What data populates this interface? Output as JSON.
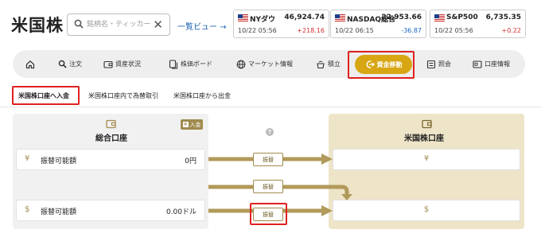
{
  "header": {
    "title": "米国株",
    "search_placeholder": "銘柄名・ティッカー",
    "list_view_label": "一覧ビュー →"
  },
  "tickers": [
    {
      "name": "NYダウ",
      "value": "46,924.74",
      "time": "10/22 05:56",
      "change": "+218.16",
      "direction": "up"
    },
    {
      "name": "NASDAQ総合",
      "value": "22,953.66",
      "time": "10/22 06:15",
      "change": "-36.87",
      "direction": "down"
    },
    {
      "name": "S&P500",
      "value": "6,735.35",
      "time": "10/22 05:56",
      "change": "+0.22",
      "direction": "up"
    }
  ],
  "nav": {
    "items": [
      {
        "label": "",
        "icon": "home-icon"
      },
      {
        "label": "注文",
        "icon": "search-icon"
      },
      {
        "label": "資産状況",
        "icon": "wallet-icon"
      },
      {
        "label": "株価ボード",
        "icon": "board-icon"
      },
      {
        "label": "マーケット情報",
        "icon": "globe-icon"
      },
      {
        "label": "積立",
        "icon": "pot-icon"
      },
      {
        "label": "資金移動",
        "icon": "transfer-icon"
      },
      {
        "label": "照会",
        "icon": "list-icon"
      },
      {
        "label": "口座情報",
        "icon": "account-icon"
      }
    ],
    "active": "資金移動"
  },
  "subtabs": [
    {
      "label": "米国株口座へ入金",
      "active": true
    },
    {
      "label": "米国株口座内で為替取引",
      "active": false
    },
    {
      "label": "米国株口座から出金",
      "active": false
    }
  ],
  "left_account": {
    "title": "総合口座",
    "deposit_label": "入金",
    "rows": [
      {
        "currency": "¥",
        "label": "振替可能額",
        "amount": "0円"
      },
      {
        "currency": "$",
        "label": "振替可能額",
        "amount": "0.00ドル"
      }
    ]
  },
  "right_account": {
    "title": "米国株口座",
    "rows": [
      {
        "currency": "¥"
      },
      {
        "currency": "$"
      }
    ]
  },
  "help_label": "?",
  "transfer_buttons": [
    {
      "label": "振替"
    },
    {
      "label": "振替"
    },
    {
      "label": "振替"
    }
  ],
  "colors": {
    "accent": "#d7a612",
    "gold_dark": "#a08a4e",
    "arrow": "#b19a5a",
    "highlight": "#e02020",
    "up": "#d32f2f",
    "down": "#1565c0"
  }
}
